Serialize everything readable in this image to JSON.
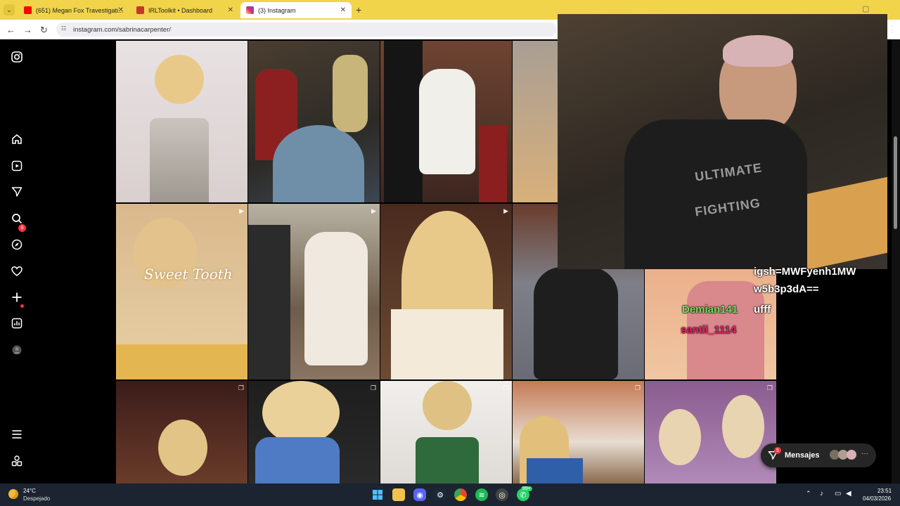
{
  "browser": {
    "tabs": [
      {
        "title": "(651) Megan Fox Travestigati...",
        "favicon": "youtube-icon",
        "color": "#ff0000"
      },
      {
        "title": "IRLToolkit • Dashboard",
        "favicon": "irltoolkit-icon",
        "color": "#c0392b"
      },
      {
        "title": "(3) Instagram",
        "favicon": "instagram-icon",
        "color": "#d6249f",
        "active": true
      }
    ],
    "url": "instagram.com/sabrinacarpenter/",
    "new_tab": "+"
  },
  "instagram": {
    "notification_badge": "8"
  },
  "stream_overlay": {
    "chat_lines": [
      {
        "user": "",
        "text": "igsh=MWFyenh1MW",
        "color": "#ffffff"
      },
      {
        "user": "",
        "text": "w5b3p3dA==",
        "color": "#ffffff"
      },
      {
        "user": "Demian141",
        "text": "ufff",
        "user_color": "#6ee05a"
      },
      {
        "user": "santii_1114",
        "text": "",
        "user_color": "#e0245e"
      }
    ]
  },
  "messages_pill": {
    "label": "Mensajes",
    "badge": "5"
  },
  "taskbar": {
    "weather_temp": "24°C",
    "weather_desc": "Despejado",
    "time": "23:51",
    "date": "04/03/2026",
    "whatsapp_badge": "99+"
  }
}
